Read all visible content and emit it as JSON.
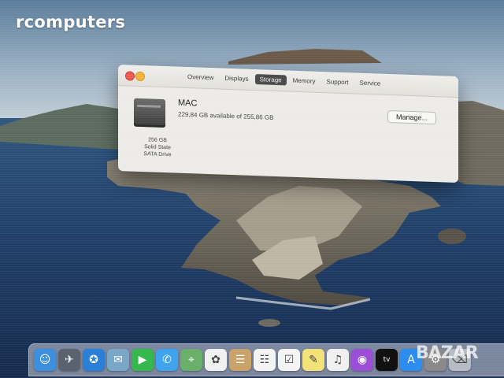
{
  "watermark": {
    "text": "rcomputers"
  },
  "window": {
    "tabs": [
      {
        "label": "Overview",
        "active": false
      },
      {
        "label": "Displays",
        "active": false
      },
      {
        "label": "Storage",
        "active": true
      },
      {
        "label": "Memory",
        "active": false
      },
      {
        "label": "Support",
        "active": false
      },
      {
        "label": "Service",
        "active": false
      }
    ],
    "storage": {
      "drive_name": "MAC",
      "available_text": "229,84 GB available of 255,86 GB",
      "capacity": "256 GB",
      "type_line1": "Solid State",
      "type_line2": "SATA Drive",
      "manage_label": "Manage..."
    },
    "colors": {
      "close": "#ee5b50",
      "minimize": "#f3b43a",
      "active_tab": "#4a4a4a"
    }
  },
  "dock": {
    "items": [
      {
        "icon": "finder-icon",
        "glyph": "☺",
        "color": "#3d8fe0"
      },
      {
        "icon": "launchpad-icon",
        "glyph": "✈",
        "color": "#5a6270"
      },
      {
        "icon": "safari-icon",
        "glyph": "✪",
        "color": "#2c7fd8"
      },
      {
        "icon": "photo-icon",
        "glyph": "✉",
        "color": "#7aa6c8"
      },
      {
        "icon": "facetime-icon",
        "glyph": "▶",
        "color": "#35b84d"
      },
      {
        "icon": "messages-icon",
        "glyph": "✆",
        "color": "#3fa3f0"
      },
      {
        "icon": "maps-icon",
        "glyph": "⌖",
        "color": "#6ab06a"
      },
      {
        "icon": "photos-icon",
        "glyph": "✿",
        "color": "#f1f1f1"
      },
      {
        "icon": "contacts-icon",
        "glyph": "☰",
        "color": "#c9a36a"
      },
      {
        "icon": "calendar-icon",
        "glyph": "☷",
        "color": "#f4f4f4"
      },
      {
        "icon": "reminders-icon",
        "glyph": "☑",
        "color": "#f4f4f4"
      },
      {
        "icon": "notes-icon",
        "glyph": "✎",
        "color": "#f3e27a"
      },
      {
        "icon": "music-icon",
        "glyph": "♫",
        "color": "#f0f0f0"
      },
      {
        "icon": "podcasts-icon",
        "glyph": "◉",
        "color": "#9b4fd6"
      },
      {
        "icon": "appletv-icon",
        "glyph": "tv",
        "color": "#111111"
      },
      {
        "icon": "appstore-icon",
        "glyph": "A",
        "color": "#2d8cf0"
      },
      {
        "icon": "preferences-icon",
        "glyph": "⚙",
        "color": "#8a8a8a"
      },
      {
        "icon": "trash-icon",
        "glyph": "⌫",
        "color": "#b7bcc4"
      }
    ]
  },
  "corner_logo": {
    "text": "BAZAR"
  }
}
